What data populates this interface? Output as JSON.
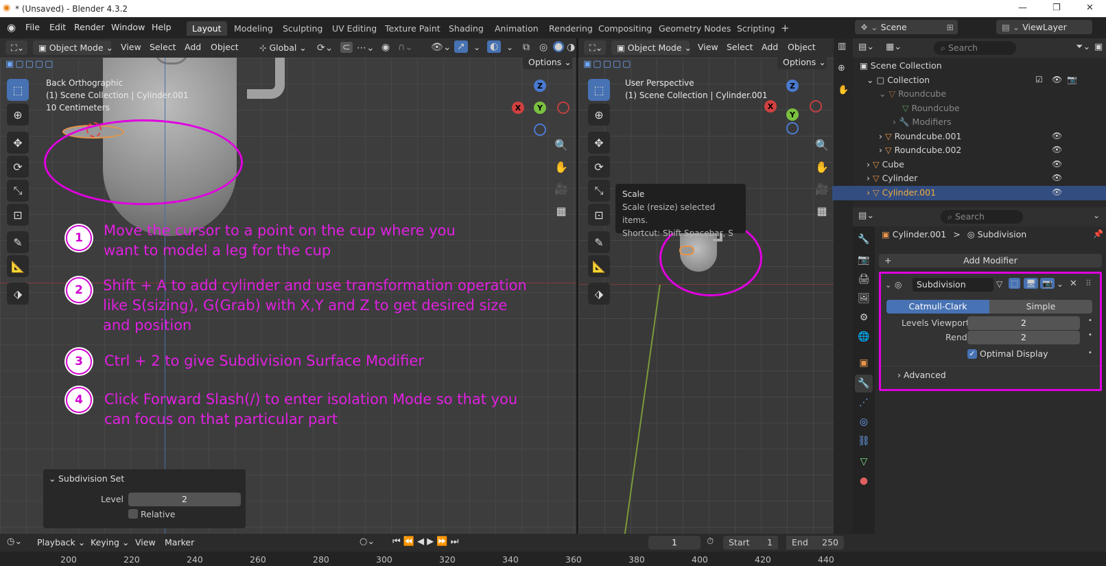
{
  "window": {
    "title": "* (Unsaved) - Blender 4.3.2",
    "controls": [
      "—",
      "❐",
      "✕"
    ]
  },
  "menu": [
    "File",
    "Edit",
    "Render",
    "Window",
    "Help"
  ],
  "workspaces": [
    "Layout",
    "Modeling",
    "Sculpting",
    "UV Editing",
    "Texture Paint",
    "Shading",
    "Animation",
    "Rendering",
    "Compositing",
    "Geometry Nodes",
    "Scripting"
  ],
  "workspace_add": "+",
  "scene": {
    "name": "Scene",
    "view_layer": "ViewLayer"
  },
  "left_viewport": {
    "mode": "Object Mode",
    "menus": [
      "View",
      "Select",
      "Add",
      "Object"
    ],
    "orientation": "Global",
    "options": "Options",
    "overlay": {
      "line1": "Back Orthographic",
      "line2": "(1) Scene Collection | Cylinder.001",
      "line3": "10 Centimeters"
    },
    "operator_panel": {
      "title": "Subdivision Set",
      "level_label": "Level",
      "level_value": "2",
      "relative_label": "Relative"
    }
  },
  "right_viewport": {
    "mode": "Object Mode",
    "menus": [
      "View",
      "Select",
      "Add",
      "Object"
    ],
    "options": "Options",
    "overlay": {
      "line1": "User Perspective",
      "line2": "(1) Scene Collection | Cylinder.001"
    },
    "tooltip": {
      "title": "Scale",
      "desc": "Scale (resize) selected items.",
      "shortcut": "Shortcut: Shift Spacebar, S"
    }
  },
  "axes": {
    "x": "X",
    "y": "Y",
    "z": "Z"
  },
  "steps": [
    {
      "num": "1",
      "text1": "Move the cursor to a point on the cup where you",
      "text2": "want to model a leg for the cup",
      "text3": ""
    },
    {
      "num": "2",
      "text1": "Shift + A to add cylinder and use transformation operation",
      "text2": "like S(sizing), G(Grab) with X,Y and Z to get desired size",
      "text3": "and position"
    },
    {
      "num": "3",
      "text1": "Ctrl + 2 to give Subdivision Surface Modifier",
      "text2": "",
      "text3": ""
    },
    {
      "num": "4",
      "text1": "Click Forward Slash(/) to enter isolation Mode so that you",
      "text2": "can focus on that particular part",
      "text3": ""
    }
  ],
  "outliner": {
    "search_placeholder": "Search",
    "items": [
      {
        "label": "Scene Collection"
      },
      {
        "label": "Collection"
      },
      {
        "label": "Roundcube"
      },
      {
        "label": "Roundcube"
      },
      {
        "label": "Modifiers"
      },
      {
        "label": "Roundcube.001"
      },
      {
        "label": "Roundcube.002"
      },
      {
        "label": "Cube"
      },
      {
        "label": "Cylinder"
      },
      {
        "label": "Cylinder.001"
      }
    ]
  },
  "properties": {
    "search_placeholder": "Search",
    "breadcrumb_object": "Cylinder.001",
    "breadcrumb_sep": ">",
    "breadcrumb_modifier": "Subdivision",
    "add_modifier": "Add Modifier",
    "add_plus": "+",
    "modifier_name": "Subdivision",
    "catmull": "Catmull-Clark",
    "simple": "Simple",
    "levels_viewport_label": "Levels Viewport",
    "levels_viewport_value": "2",
    "render_label": "Render",
    "render_value": "2",
    "optimal_display": "Optimal Display",
    "advanced": "Advanced"
  },
  "timeline": {
    "playback": "Playback",
    "keying": "Keying",
    "view": "View",
    "marker": "Marker",
    "current_frame": "1",
    "start_label": "Start",
    "start_value": "1",
    "end_label": "End",
    "end_value": "250",
    "ticks": [
      "200",
      "220",
      "240",
      "260",
      "280",
      "300",
      "320",
      "340",
      "360",
      "380",
      "400",
      "420",
      "440"
    ]
  },
  "colors": {
    "accent": "#4772b3",
    "annotation": "#e020e0",
    "selected_row": "#334d80"
  }
}
